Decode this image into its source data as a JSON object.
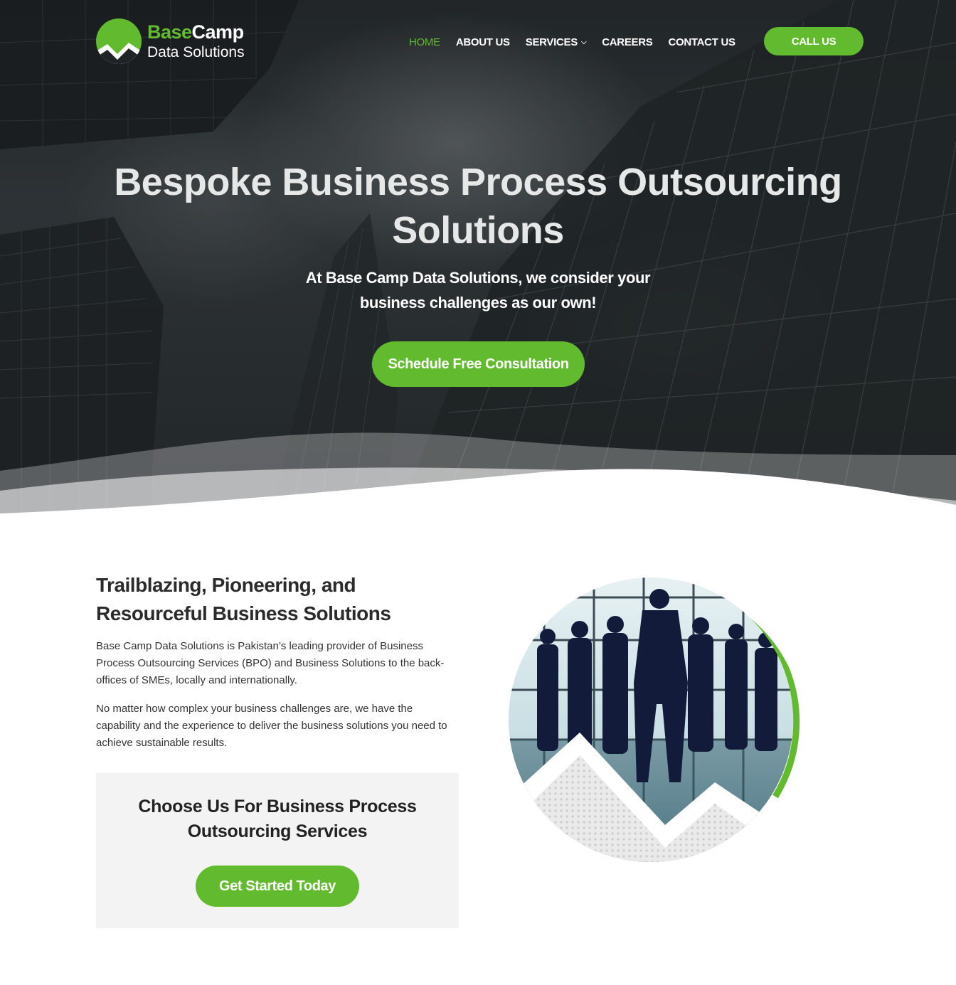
{
  "brand": {
    "name_part1": "Base",
    "name_part2": "Camp",
    "tagline": "Data Solutions",
    "accent_color": "#62bb2f"
  },
  "nav": {
    "items": [
      {
        "label": "HOME",
        "active": true
      },
      {
        "label": "ABOUT US",
        "active": false
      },
      {
        "label": "SERVICES",
        "active": false,
        "has_dropdown": true
      },
      {
        "label": "CAREERS",
        "active": false
      },
      {
        "label": "CONTACT US",
        "active": false
      }
    ],
    "dropdown_icon": "chevron-down-icon",
    "call_label": "CALL US"
  },
  "hero": {
    "title": "Bespoke Business Process Outsourcing Solutions",
    "subtitle": "At Base Camp Data Solutions, we consider your business challenges as our own!",
    "button_label": "Schedule Free Consultation"
  },
  "about": {
    "title": "Trailblazing, Pioneering, and Resourceful Business Solutions",
    "paragraph1": "Base Camp Data Solutions is Pakistan’s leading provider of Business Process Outsourcing Services (BPO) and Business Solutions to the back-offices of SMEs, locally and internationally.",
    "paragraph2": "No matter how complex your business challenges are, we have the capability and the experience to deliver the business solutions you need to achieve sustainable results."
  },
  "cta": {
    "title": "Choose Us For Business Process Outsourcing Services",
    "button_label": "Get Started Today"
  }
}
